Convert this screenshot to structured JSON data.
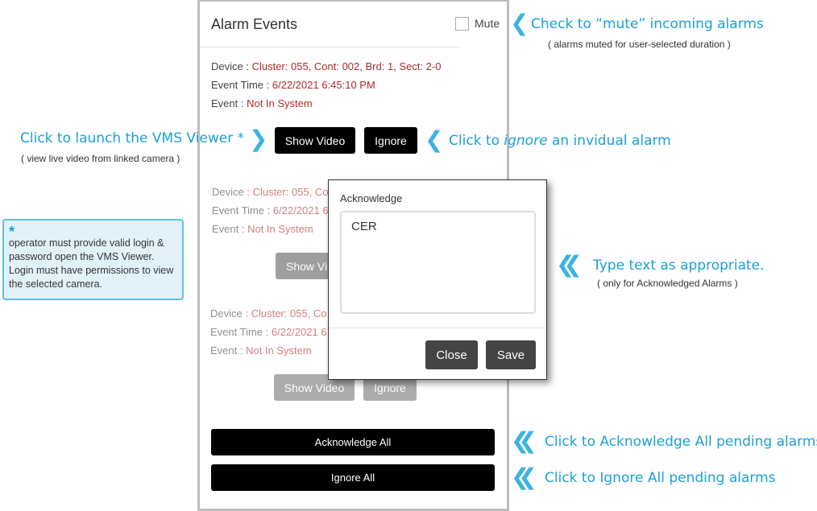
{
  "panel": {
    "title": "Alarm Events",
    "mute_label": "Mute",
    "events": [
      {
        "device_label": "Device : ",
        "device": "Cluster: 055, Cont: 002, Brd: 1, Sect: 2-0",
        "time_label": "Event Time : ",
        "time": "6/22/2021 6:45:10 PM",
        "event_label": "Event : ",
        "event": "Not In System",
        "show_video": "Show Video",
        "ignore": "Ignore"
      },
      {
        "device_label": "Device : ",
        "device": "Cluster: 055, Co",
        "time_label": "Event Time : ",
        "time": "6/22/2021 6",
        "event_label": "Event : ",
        "event": "Not In System",
        "show_video": "Show Vi"
      },
      {
        "device_label": "Device : ",
        "device": "Cluster: 055, Co",
        "time_label": "Event Time : ",
        "time": "6/22/2021 6",
        "event_label": "Event : ",
        "event": "Not In System",
        "show_video": "Show Video",
        "ignore": "Ignore"
      }
    ],
    "acknowledge_all": "Acknowledge All",
    "ignore_all": "Ignore All"
  },
  "modal": {
    "label": "Acknowledge",
    "text": "CER",
    "close": "Close",
    "save": "Save"
  },
  "annotations": {
    "mute": "Check to “mute” incoming alarms",
    "mute_sub": "( alarms muted for user-selected duration )",
    "vms": "Click to launch the VMS Viewer *",
    "vms_sub": "( view live video from linked camera )",
    "ignore_pre": "Click to ",
    "ignore_em": "ignore",
    "ignore_post": " an invidual alarm",
    "type": "Type text as appropriate.",
    "type_sub": "( only for Acknowledged Alarms )",
    "ack_all": "Click to Acknowledge All pending alarms",
    "ignore_all": "Click to Ignore All pending alarms",
    "note_star": "*",
    "note": "operator must provide valid login & password open the VMS Viewer. Login must have permissions to view the selected camera."
  },
  "colors": {
    "annotation": "#1aa0d8",
    "value": "#b02a2a",
    "note_bg": "#e2f2fa"
  }
}
